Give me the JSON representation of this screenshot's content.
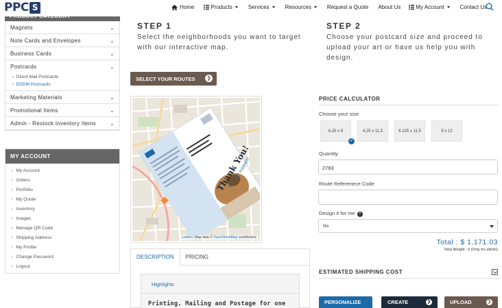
{
  "brand": {
    "logo_text": "PPC",
    "logo_box": "S"
  },
  "nav": {
    "home": "Home",
    "products": "Products",
    "services": "Services",
    "resources": "Resources",
    "quote": "Request a Quote",
    "about": "About Us",
    "account": "My Account",
    "contact": "Contact Us"
  },
  "sidebar": {
    "header": "PRODUCT CATEGORY",
    "items": [
      "Magnets",
      "Note Cards and Envelopes",
      "Business Cards",
      "Postcards"
    ],
    "sub_items": [
      "Direct Mail Postcards",
      "EDDM Postcards"
    ],
    "items_after": [
      "Marketing Materials",
      "Promotional Items",
      "Admin - Restock Inventory Items"
    ]
  },
  "account": {
    "header": "MY ACCOUNT",
    "items": [
      "My Account",
      "Orders",
      "Portfolio",
      "My Quote",
      "Inventory",
      "Images",
      "Manage QR Code",
      "Shipping Address",
      "My Profile",
      "Change Password",
      "Logout"
    ]
  },
  "step1": {
    "title": "STEP 1",
    "line1": "Select the neighborhoods you want to target",
    "line2": "with our interactive map."
  },
  "step2": {
    "title": "STEP 2",
    "line1": "Choose your postcard size and proceed to",
    "line2": "upload your art or have us help you with",
    "line3": "design."
  },
  "routes_button": "SELECT YOUR ROUTES",
  "map": {
    "attr_leaflet": "Leaflet",
    "attr_text": "| Map data ©",
    "attr_osm": "OpenStreetMap",
    "attr_tail": "contributors",
    "card_text1": "Thank You!",
    "card_text2": "for your support!"
  },
  "tabs": {
    "description": "DESCRIPTION",
    "pricing": "PRICING",
    "highlights": "Highlights",
    "subtitle": "Printing, Mailing and Postage for one"
  },
  "calculator": {
    "title": "PRICE CALCULATOR",
    "choose_size": "Choose your size",
    "sizes": [
      "6.25 x 9",
      "4.25 x 11.5",
      "6.125 x 11.5",
      "9 x 12"
    ],
    "quantity_label": "Quantity",
    "quantity": "2783",
    "route_label": "Route Referenece Code",
    "route_value": "",
    "design_label": "Design it for me",
    "design_value": "No",
    "total": "Total : $ 1,171.03",
    "weight": "Total Weight :  0 (Only for admin)"
  },
  "shipping": {
    "title": "ESTIMATED SHIPPING COST"
  },
  "bottom_buttons": {
    "personalize": "PERSONALIZE",
    "create": "CREATE",
    "upload": "UPLOAD"
  },
  "colors": {
    "brand_navy": "#233f6a",
    "accent_blue": "#1c6aa8",
    "routes_brown": "#6b5a50",
    "header_gray": "#666666",
    "upload_brown": "#6b5a50",
    "create_navy": "#1d2a3a"
  }
}
